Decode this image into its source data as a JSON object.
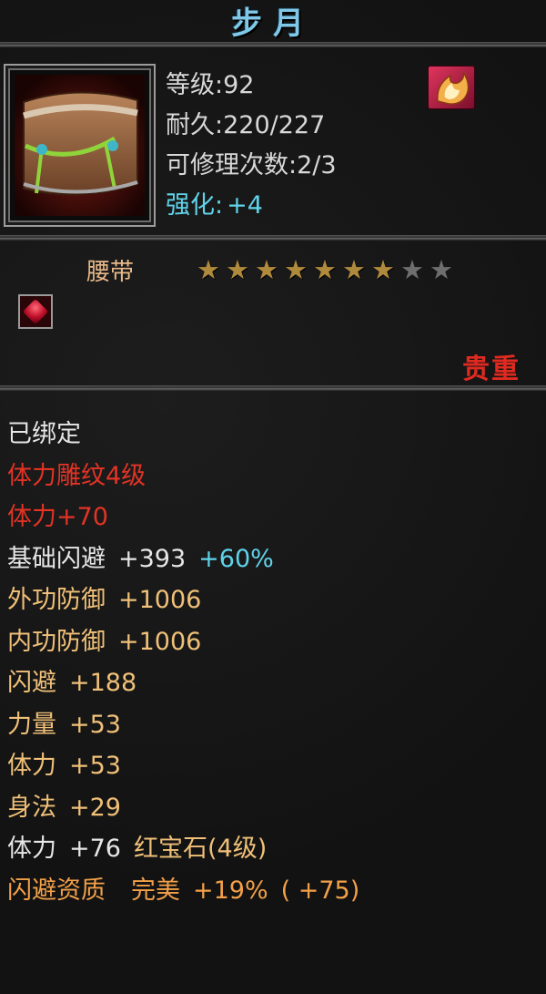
{
  "item": {
    "name": "步月",
    "level_label": "等级",
    "level": ":92",
    "durability_label": "耐久",
    "durability": ":220/227",
    "repair_label": "可修理次数",
    "repair": ":2/3",
    "enhance_label": "强化:",
    "enhance": "+4",
    "type": "腰带",
    "stars_total": 9,
    "stars_filled": 7,
    "quality": "贵重"
  },
  "attributes": {
    "bound": "已绑定",
    "engrave": "体力雕纹4级",
    "engrave_bonus": "体力+70",
    "base_dodge_label": "基础闪避",
    "base_dodge_value": "+393",
    "base_dodge_pct": "+60%",
    "ext_def_label": "外功防御",
    "ext_def_value": "+1006",
    "int_def_label": "内功防御",
    "int_def_value": "+1006",
    "dodge_label": "闪避",
    "dodge_value": "+188",
    "strength_label": "力量",
    "strength_value": "+53",
    "stamina_label": "体力",
    "stamina_value": "+53",
    "agility_label": "身法",
    "agility_value": "+29",
    "gem_stat_label": "体力",
    "gem_stat_value": "+76",
    "gem_name": "红宝石(4级)",
    "aptitude_label": "闪避资质",
    "aptitude_grade": "完美",
    "aptitude_pct": "+19%",
    "aptitude_bonus": "( +75)"
  },
  "colors": {
    "title": "#7fc8e8",
    "enhance": "#5fd3ea",
    "quality": "#e02a20",
    "engrave": "#e23325",
    "bonus": "#f0c078",
    "aptitude": "#f2a048"
  }
}
